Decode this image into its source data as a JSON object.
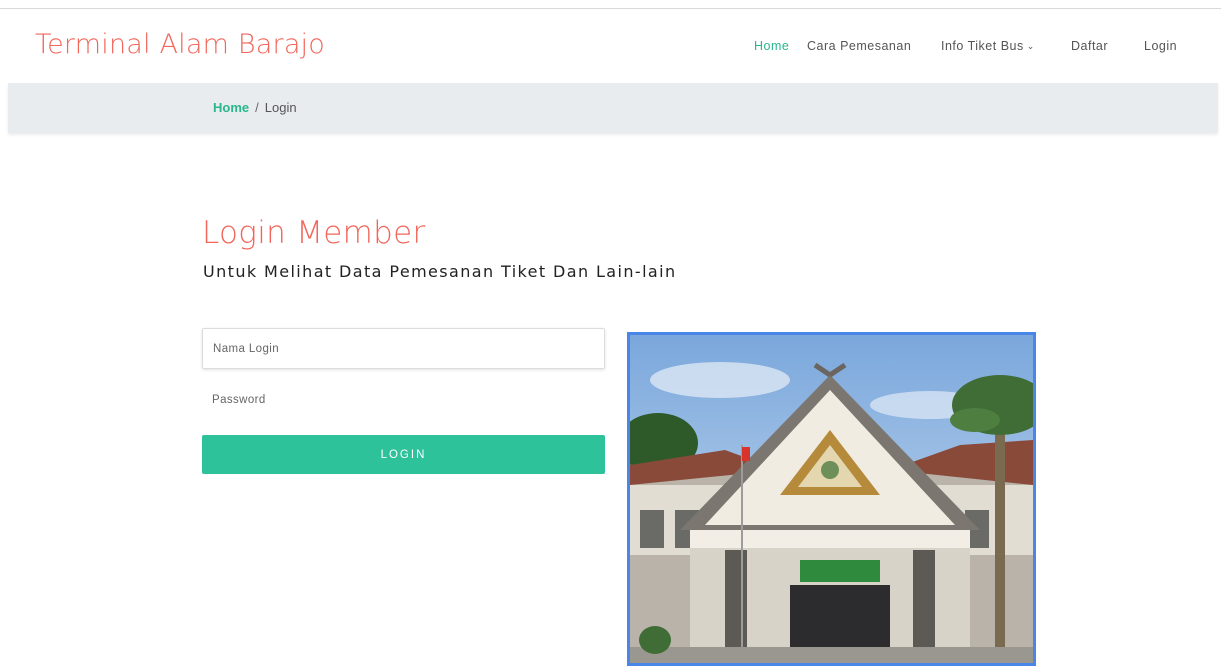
{
  "brand": {
    "name": "Terminal Alam Barajo"
  },
  "nav": {
    "items": [
      {
        "label": "Home"
      },
      {
        "label": "Cara Pemesanan"
      },
      {
        "label": "Info Tiket Bus"
      },
      {
        "label": "Daftar"
      },
      {
        "label": "Login"
      }
    ],
    "dropdown_icon": "chevron-down-icon"
  },
  "breadcrumb": {
    "home": "Home",
    "separator": "/",
    "current": "Login"
  },
  "login": {
    "title": "Login Member",
    "subtitle": "Untuk Melihat Data Pemesanan Tiket Dan Lain-lain",
    "username_placeholder": "Nama Login",
    "username_value": "",
    "password_placeholder": "Password",
    "password_value": "",
    "button_label": "LOGIN"
  },
  "colors": {
    "brand": "#f2665c",
    "accent": "#2bb68e",
    "button": "#2ec29a",
    "breadcrumb_bg": "#e9ecef",
    "photo_border": "#4a86e8"
  }
}
